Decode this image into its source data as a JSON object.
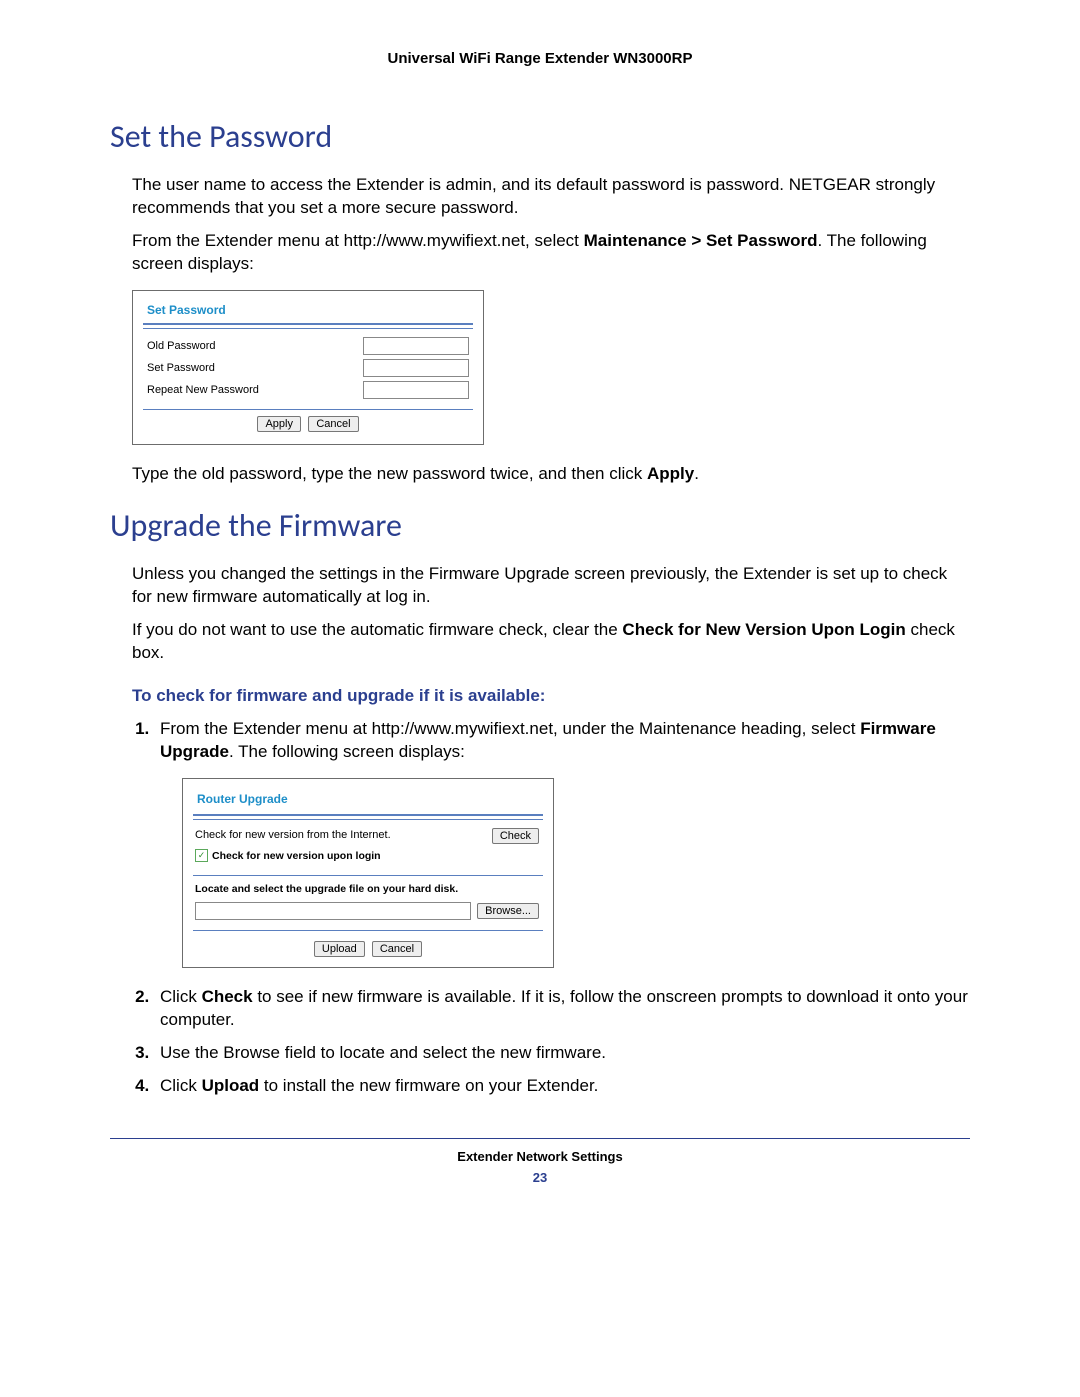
{
  "header": {
    "title": "Universal WiFi Range Extender WN3000RP"
  },
  "section1": {
    "heading": "Set the Password",
    "p1": "The user name to access the Extender is admin, and its default password is password. NETGEAR strongly recommends that you set a more secure password.",
    "p2_pre": "From the Extender menu at http://www.mywifiext.net, select ",
    "p2_bold": "Maintenance > Set Password",
    "p2_post": ". The following screen displays:",
    "p3_pre": "Type the old password, type the new password twice, and then click ",
    "p3_bold": "Apply",
    "p3_post": "."
  },
  "ss1": {
    "title": "Set Password",
    "old": "Old Password",
    "set": "Set Password",
    "repeat": "Repeat New Password",
    "apply": "Apply",
    "cancel": "Cancel"
  },
  "section2": {
    "heading": "Upgrade the Firmware",
    "p1": "Unless you changed the settings in the Firmware Upgrade screen previously, the Extender is set up to check for new firmware automatically at log in.",
    "p2_pre": "If you do not want to use the automatic firmware check, clear the ",
    "p2_bold": "Check for New Version Upon Login",
    "p2_post": " check box.",
    "sub": "To check for firmware and upgrade if it is available:",
    "li1_pre": "From the Extender menu at http://www.mywifiext.net, under the Maintenance heading, select ",
    "li1_bold": "Firmware Upgrade",
    "li1_post": ". The following screen displays:",
    "li2_pre": "Click ",
    "li2_bold": "Check",
    "li2_post": " to see if new firmware is available. If it is, follow the onscreen prompts to download it onto your computer.",
    "li3": "Use the Browse field to locate and select the new firmware.",
    "li4_pre": "Click ",
    "li4_bold": "Upload",
    "li4_post": " to install the new firmware on your Extender."
  },
  "ss2": {
    "title": "Router Upgrade",
    "checkLabel": "Check for new version from the Internet.",
    "checkBtn": "Check",
    "chkMark": "✓",
    "chkText": "Check for new version upon login",
    "locate": "Locate and select the upgrade file on your hard disk.",
    "browse": "Browse...",
    "upload": "Upload",
    "cancel": "Cancel"
  },
  "footer": {
    "title": "Extender Network Settings",
    "page": "23"
  }
}
